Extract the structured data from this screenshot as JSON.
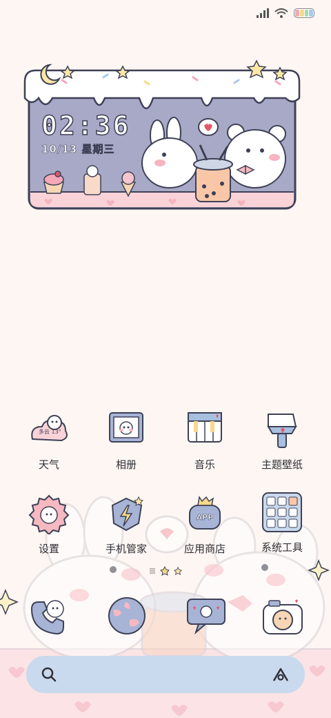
{
  "status_bar": {
    "icons": [
      "signal-icon",
      "wifi-icon",
      "battery-icon"
    ],
    "battery_colors": [
      "#f6a7b8",
      "#f6d98a",
      "#a8d8b0",
      "#a8c8f0"
    ]
  },
  "widget": {
    "time": "02:36",
    "date": "10/13  星期三"
  },
  "apps": [
    {
      "label": "天气",
      "icon": "weather-icon",
      "weather_text": "多云 13°"
    },
    {
      "label": "相册",
      "icon": "gallery-icon"
    },
    {
      "label": "音乐",
      "icon": "music-icon"
    },
    {
      "label": "主题壁纸",
      "icon": "theme-icon"
    },
    {
      "label": "设置",
      "icon": "settings-icon"
    },
    {
      "label": "手机管家",
      "icon": "security-icon"
    },
    {
      "label": "应用商店",
      "icon": "app-store-icon",
      "badge_text": "APP"
    },
    {
      "label": "系统工具",
      "icon": "tools-folder-icon"
    }
  ],
  "dock": [
    {
      "icon": "phone-icon"
    },
    {
      "icon": "browser-icon"
    },
    {
      "icon": "messages-icon"
    },
    {
      "icon": "camera-icon"
    }
  ],
  "search_bar": {
    "left_icon": "search-icon",
    "right_icon": "assistant-icon"
  },
  "colors": {
    "background": "#fdf6f2",
    "widget_purple": "#a7a9c6",
    "widget_pink": "#f9d3d8",
    "search_bar": "#c9d9ee",
    "outline": "#3d4055"
  }
}
